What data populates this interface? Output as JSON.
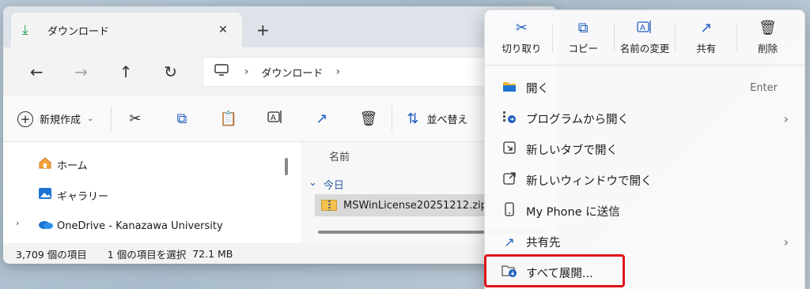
{
  "tab": {
    "title": "ダウンロード",
    "close_glyph": "✕",
    "new_tab_glyph": "+"
  },
  "nav": {
    "back": "←",
    "forward": "→",
    "up": "↑",
    "refresh": "↻",
    "separator": "›",
    "crumb": "ダウンロード",
    "crumb_chevron": "›"
  },
  "cmdbar": {
    "new_label": "新規作成",
    "new_chevron": "⌄",
    "sort_label": "並べ替え"
  },
  "sidebar": {
    "items": [
      {
        "label": "ホーム",
        "icon": "home-icon"
      },
      {
        "label": "ギャラリー",
        "icon": "gallery-icon"
      },
      {
        "label": "OneDrive - Kanazawa University",
        "icon": "onedrive-icon"
      }
    ],
    "expand_glyph": "›"
  },
  "filepane": {
    "column_name": "名前",
    "group_chevron": "⌄",
    "group_label": "今日",
    "file_name": "MSWinLicense20251212.zip"
  },
  "status": {
    "item_count": "3,709 個の項目",
    "selection": "1 個の項目を選択",
    "size": "72.1 MB"
  },
  "context_menu": {
    "top_buttons": [
      {
        "label": "切り取り",
        "icon": "scissors-icon"
      },
      {
        "label": "コピー",
        "icon": "copy-icon"
      },
      {
        "label": "名前の変更",
        "icon": "rename-icon"
      },
      {
        "label": "共有",
        "icon": "share-icon"
      },
      {
        "label": "削除",
        "icon": "trash-icon"
      }
    ],
    "items": [
      {
        "label": "開く",
        "shortcut": "Enter",
        "icon": "folder-open-icon"
      },
      {
        "label": "プログラムから開く",
        "arrow": "›",
        "icon": "open-with-icon"
      },
      {
        "label": "新しいタブで開く",
        "icon": "new-tab-icon"
      },
      {
        "label": "新しいウィンドウで開く",
        "icon": "new-window-icon"
      },
      {
        "label": "My Phone に送信",
        "icon": "phone-icon"
      },
      {
        "label": "共有先",
        "arrow": "›",
        "icon": "share-icon"
      },
      {
        "label": "すべて展開...",
        "icon": "extract-icon"
      }
    ]
  },
  "colors": {
    "accent": "#1f5fbf",
    "highlight_box": "#e0141a",
    "download_green": "#1a9a53"
  }
}
